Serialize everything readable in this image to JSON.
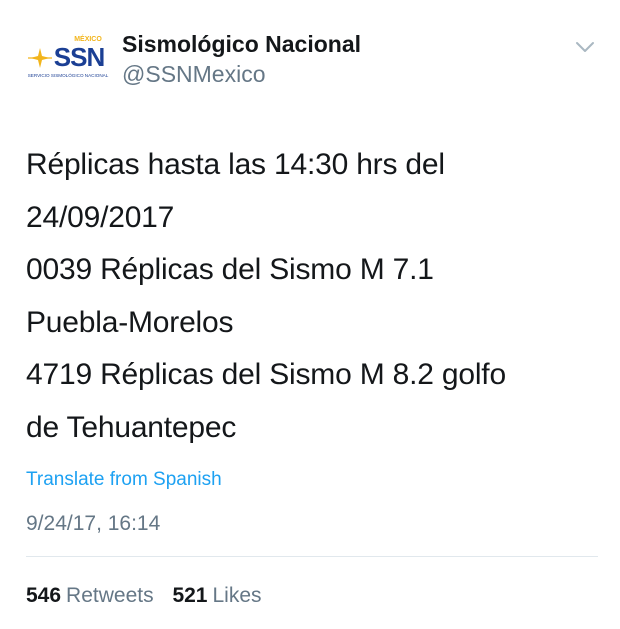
{
  "account": {
    "display_name": "Sismológico Nacional",
    "handle": "@SSNMexico",
    "avatar": {
      "logo_text": "SSN",
      "country_text": "MÉXICO",
      "subtitle_text": "SERVICIO SISMOLÓGICO NACIONAL",
      "logo_color": "#1b3f94",
      "accent_color": "#f2b51c"
    }
  },
  "menu": {
    "caret_icon": "chevron-down-icon"
  },
  "tweet": {
    "lines": [
      "Réplicas hasta las 14:30 hrs del",
      "24/09/2017",
      "0039 Réplicas del Sismo M 7.1",
      "Puebla-Morelos",
      "4719 Réplicas del Sismo M 8.2 golfo",
      "de Tehuantepec"
    ],
    "translate_link": "Translate from Spanish",
    "timestamp": "9/24/17, 16:14"
  },
  "stats": {
    "retweets_count": "546",
    "retweets_label": "Retweets",
    "likes_count": "521",
    "likes_label": "Likes"
  },
  "colors": {
    "text": "#14171a",
    "secondary": "#657786",
    "link": "#1da1f2",
    "divider": "#e1e8ed"
  }
}
